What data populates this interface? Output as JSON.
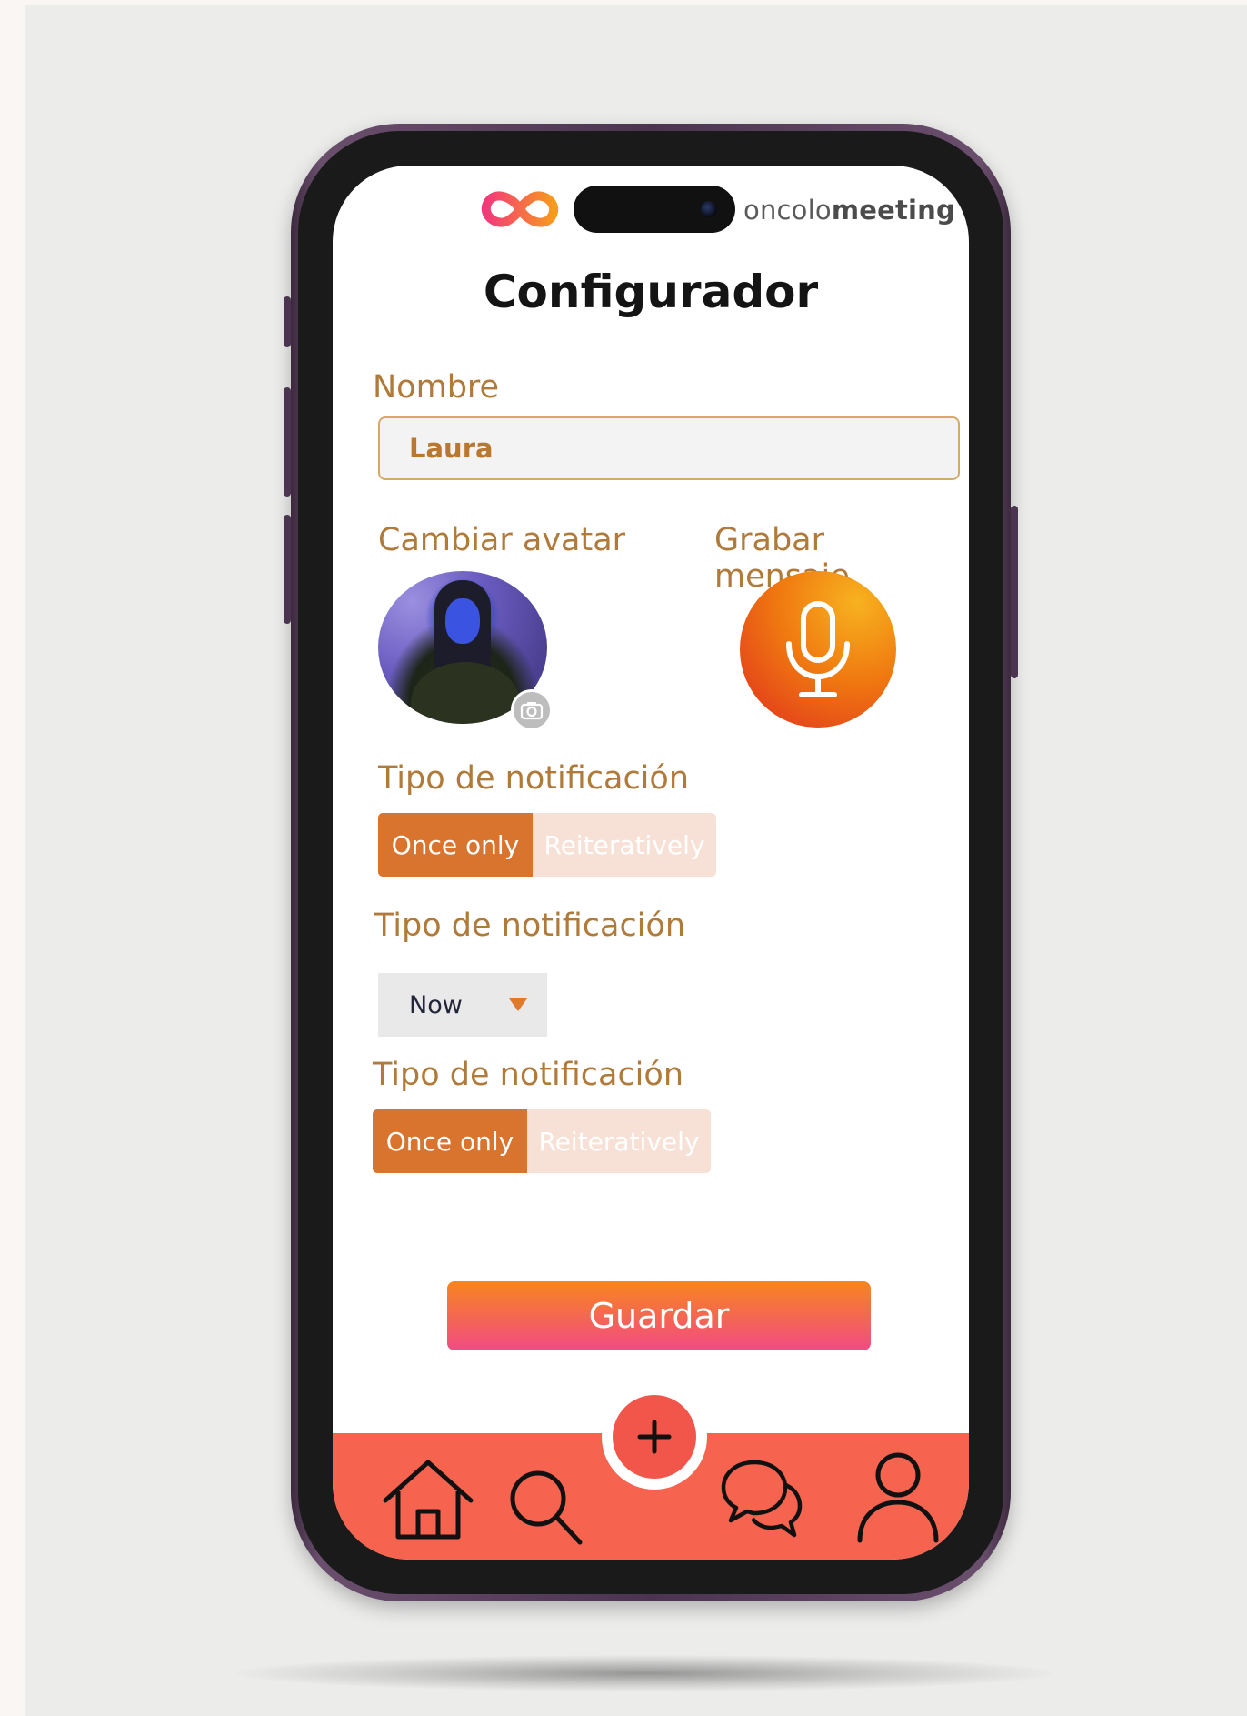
{
  "app": {
    "brand_light": "oncolo",
    "brand_bold": "meeting",
    "title": "Configurador"
  },
  "form": {
    "name_label": "Nombre",
    "name_value": "Laura",
    "avatar_label": "Cambiar avatar",
    "record_label": "Grabar mensaje",
    "notification1": {
      "label": "Tipo de notificación",
      "options": [
        "Once only",
        "Reiteratively"
      ],
      "selected": "Once only"
    },
    "notification2": {
      "label": "Tipo de notificación",
      "value": "Now"
    },
    "notification3": {
      "label": "Tipo de notificación",
      "options": [
        "Once only",
        "Reiteratively"
      ],
      "selected": "Once only"
    },
    "save_label": "Guardar"
  },
  "nav": {
    "items": [
      "home-icon",
      "search-icon",
      "add-icon",
      "chat-icon",
      "profile-icon"
    ],
    "fab_glyph": "+"
  },
  "colors": {
    "accent": "#d9742f",
    "label": "#b07a3a",
    "nav_bg": "#f66450",
    "save_gradient_top": "#f7861f",
    "save_gradient_bottom": "#f24b83"
  }
}
